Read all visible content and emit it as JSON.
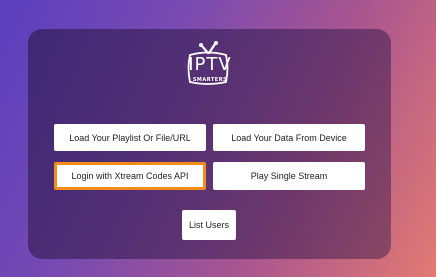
{
  "logo": {
    "icon": "tv-antenna-icon",
    "word": "IPTV",
    "subword": "SMARTERS"
  },
  "buttons": {
    "load_playlist": "Load Your Playlist Or File/URL",
    "load_device": "Load Your Data From Device",
    "login_xtream": "Login with Xtream Codes API",
    "play_single": "Play Single Stream",
    "list_users": "List Users"
  },
  "colors": {
    "focus_border": "#f28c1a",
    "button_bg": "#ffffff"
  }
}
